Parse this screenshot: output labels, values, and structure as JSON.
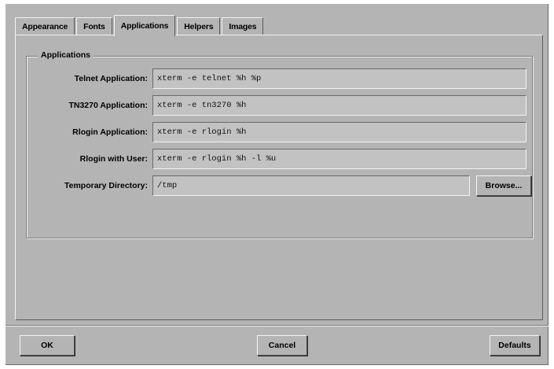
{
  "tabs": [
    {
      "label": "Appearance",
      "active": false
    },
    {
      "label": "Fonts",
      "active": false
    },
    {
      "label": "Applications",
      "active": true
    },
    {
      "label": "Helpers",
      "active": false
    },
    {
      "label": "Images",
      "active": false
    }
  ],
  "group": {
    "title": "Applications",
    "rows": [
      {
        "label": "Telnet Application:",
        "value": "xterm -e telnet %h %p"
      },
      {
        "label": "TN3270 Application:",
        "value": "xterm -e tn3270 %h"
      },
      {
        "label": "Rlogin Application:",
        "value": "xterm -e rlogin %h"
      },
      {
        "label": "Rlogin with User:",
        "value": "xterm -e rlogin %h -l %u"
      },
      {
        "label": "Temporary Directory:",
        "value": "/tmp"
      }
    ],
    "browse_label": "Browse..."
  },
  "buttons": {
    "ok": "OK",
    "cancel": "Cancel",
    "defaults": "Defaults"
  },
  "colors": {
    "background": "#b4b4b4",
    "field": "#c2c2c2",
    "shadow": "#5a5a5a",
    "highlight": "#f2f2f2"
  }
}
